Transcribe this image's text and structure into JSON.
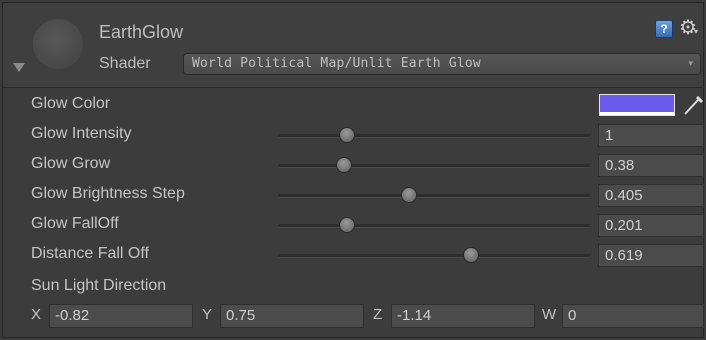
{
  "header": {
    "material_name": "EarthGlow",
    "shader_label": "Shader",
    "shader_value": "World Political Map/Unlit Earth Glow",
    "help_icon": "help-book-icon",
    "help_icon_glyph": "?",
    "settings_icon": "gear-icon"
  },
  "glow_color": {
    "label": "Glow Color",
    "color": "#6d5cec",
    "icon": "eyedropper-icon"
  },
  "properties": [
    {
      "label": "Glow Intensity",
      "value": "1",
      "slider_fraction": 0.22
    },
    {
      "label": "Glow Grow",
      "value": "0.38",
      "slider_fraction": 0.21
    },
    {
      "label": "Glow Brightness Step",
      "value": "0.405",
      "slider_fraction": 0.42
    },
    {
      "label": "Glow FallOff",
      "value": "0.201",
      "slider_fraction": 0.22
    },
    {
      "label": "Distance Fall Off",
      "value": "0.619",
      "slider_fraction": 0.62
    }
  ],
  "sun_light": {
    "label": "Sun Light Direction",
    "x_label": "X",
    "x": "-0.82",
    "y_label": "Y",
    "y": "0.75",
    "z_label": "Z",
    "z": "-1.14",
    "w_label": "W",
    "w": "0"
  }
}
